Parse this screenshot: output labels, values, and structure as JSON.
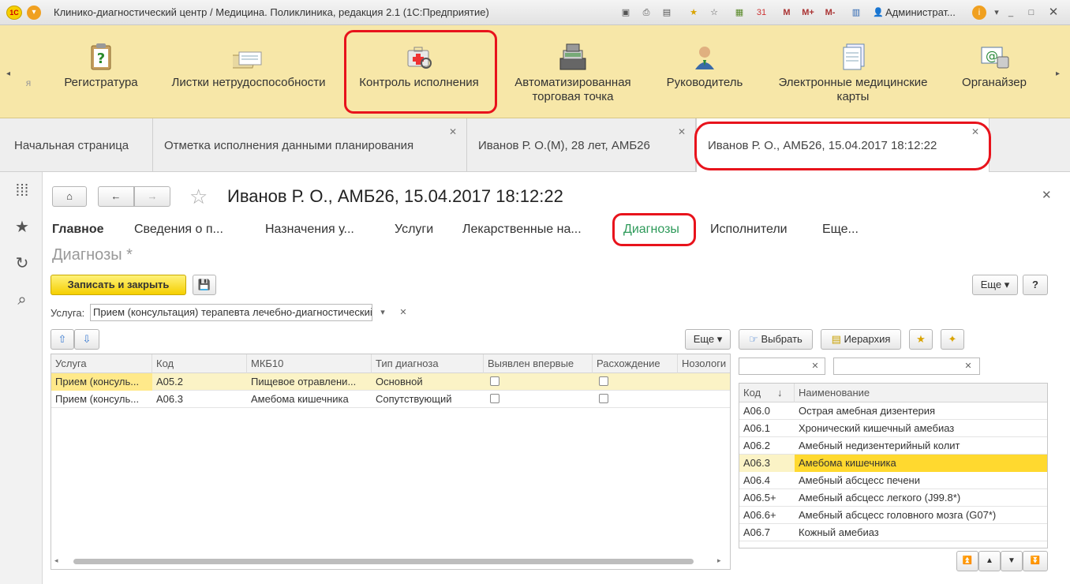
{
  "window": {
    "title": "Клинико-диагностический центр / Медицина. Поликлиника, редакция 2.1  (1С:Предприятие)",
    "user": "Администрат...",
    "memory_buttons": [
      "M",
      "M+",
      "M-"
    ]
  },
  "sections": {
    "items": [
      {
        "label": "я"
      },
      {
        "label": "Регистратура"
      },
      {
        "label": "Листки нетрудоспособности"
      },
      {
        "label": "Контроль исполнения"
      },
      {
        "label": "Автоматизированная торговая точка"
      },
      {
        "label": "Руководитель"
      },
      {
        "label": "Электронные медицинские карты"
      },
      {
        "label": "Органайзер"
      }
    ]
  },
  "tabs": [
    {
      "label": "Начальная страница"
    },
    {
      "label": "Отметка исполнения данными планирования"
    },
    {
      "label": "Иванов Р. О.(М), 28 лет, АМБ26"
    },
    {
      "label": "Иванов Р. О., АМБ26, 15.04.2017 18:12:22"
    }
  ],
  "form": {
    "title": "Иванов Р. О., АМБ26, 15.04.2017 18:12:22",
    "tabs": [
      "Главное",
      "Сведения о п...",
      "Назначения у...",
      "Услуги",
      "Лекарственные на...",
      "Диагнозы",
      "Исполнители",
      "Еще..."
    ],
    "section_title": "Диагнозы *",
    "save_close": "Записать и закрыть",
    "more": "Еще",
    "help": "?",
    "service_label": "Услуга:",
    "service_value": "Прием (консультация) терапевта лечебно-диагностический",
    "grid": {
      "columns": [
        "Услуга",
        "Код",
        "МКБ10",
        "Тип диагноза",
        "Выявлен впервые",
        "Расхождение",
        "Нозологи"
      ],
      "rows": [
        {
          "service": "Прием (консуль...",
          "code": "А05.2",
          "mkb": "Пищевое отравлени...",
          "type": "Основной",
          "first": false,
          "diff": false
        },
        {
          "service": "Прием (консуль...",
          "code": "А06.3",
          "mkb": "Амебома кишечника",
          "type": "Сопутствующий",
          "first": false,
          "diff": false
        }
      ]
    },
    "picker": {
      "select": "Выбрать",
      "hierarchy": "Иерархия",
      "columns": [
        "Код",
        "Наименование"
      ],
      "rows": [
        {
          "code": "А06.0",
          "name": "Острая амебная дизентерия"
        },
        {
          "code": "А06.1",
          "name": "Хронический кишечный амебиаз"
        },
        {
          "code": "А06.2",
          "name": "Амебный недизентерийный колит"
        },
        {
          "code": "А06.3",
          "name": "Амебома кишечника"
        },
        {
          "code": "А06.4",
          "name": "Амебный абсцесс печени"
        },
        {
          "code": "А06.5+",
          "name": "Амебный абсцесс легкого (J99.8*)"
        },
        {
          "code": "А06.6+",
          "name": "Амебный абсцесс головного мозга (G07*)"
        },
        {
          "code": "А06.7",
          "name": "Кожный амебиаз"
        }
      ],
      "selected_index": 3
    }
  },
  "colors": {
    "accent_green": "#2e9a5a",
    "highlight": "#ffd92f",
    "row_selected": "#fbf3c6",
    "red_frame": "#e8131c"
  }
}
